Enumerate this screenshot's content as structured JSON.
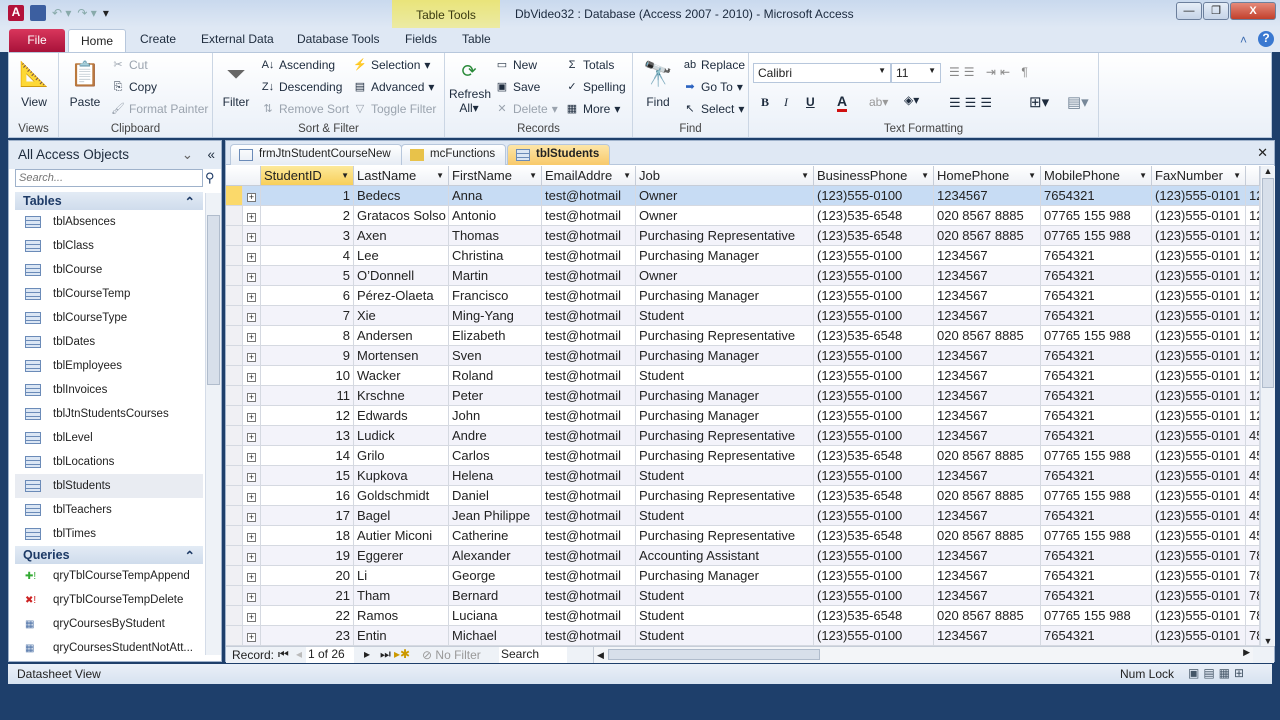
{
  "window": {
    "title": "DbVideo32 : Database (Access 2007 - 2010)  -  Microsoft Access",
    "contextual": "Table Tools",
    "min": "—",
    "max": "❐",
    "close": "X"
  },
  "ribbon_tabs": [
    "File",
    "Home",
    "Create",
    "External Data",
    "Database Tools",
    "Fields",
    "Table"
  ],
  "ribbon": {
    "views": {
      "view": "View",
      "label": "Views"
    },
    "clipboard": {
      "paste": "Paste",
      "cut": "Cut",
      "copy": "Copy",
      "format_painter": "Format Painter",
      "label": "Clipboard"
    },
    "sort_filter": {
      "filter": "Filter",
      "ascending": "Ascending",
      "descending": "Descending",
      "remove_sort": "Remove Sort",
      "selection": "Selection",
      "advanced": "Advanced",
      "toggle_filter": "Toggle Filter",
      "label": "Sort & Filter"
    },
    "records": {
      "refresh": "Refresh",
      "refresh2": "All",
      "new": "New",
      "save": "Save",
      "delete": "Delete",
      "totals": "Totals",
      "spelling": "Spelling",
      "more": "More",
      "label": "Records"
    },
    "find": {
      "find": "Find",
      "replace": "Replace",
      "goto": "Go To",
      "select": "Select",
      "label": "Find"
    },
    "text_formatting": {
      "font": "Calibri",
      "size": "11",
      "bold": "B",
      "italic": "I",
      "underline": "U",
      "label": "Text Formatting"
    }
  },
  "nav": {
    "title": "All Access Objects",
    "search_placeholder": "Search...",
    "tables_label": "Tables",
    "queries_label": "Queries",
    "tables": [
      "tblAbsences",
      "tblClass",
      "tblCourse",
      "tblCourseTemp",
      "tblCourseType",
      "tblDates",
      "tblEmployees",
      "tblInvoices",
      "tblJtnStudentsCourses",
      "tblLevel",
      "tblLocations",
      "tblStudents",
      "tblTeachers",
      "tblTimes"
    ],
    "queries": [
      "qryTblCourseTempAppend",
      "qryTblCourseTempDelete",
      "qryCoursesByStudent",
      "qryCoursesStudentNotAtt..."
    ]
  },
  "doc_tabs": [
    "frmJtnStudentCourseNew",
    "mcFunctions",
    "tblStudents"
  ],
  "columns": [
    "StudentID",
    "LastName",
    "FirstName",
    "EmailAddre",
    "Job",
    "BusinessPhone",
    "HomePhone",
    "MobilePhone",
    "FaxNumber"
  ],
  "rows": [
    [
      "1",
      "Bedecs",
      "Anna",
      "test@hotmail",
      "Owner",
      "(123)555-0100",
      "1234567",
      "7654321",
      "(123)555-0101",
      "12"
    ],
    [
      "2",
      "Gratacos Solso",
      "Antonio",
      "test@hotmail",
      "Owner",
      "(123)535-6548",
      "020 8567 8885",
      "07765 155 988",
      "(123)555-0101",
      "12"
    ],
    [
      "3",
      "Axen",
      "Thomas",
      "test@hotmail",
      "Purchasing Representative",
      "(123)535-6548",
      "020 8567 8885",
      "07765 155 988",
      "(123)555-0101",
      "12"
    ],
    [
      "4",
      "Lee",
      "Christina",
      "test@hotmail",
      "Purchasing Manager",
      "(123)555-0100",
      "1234567",
      "7654321",
      "(123)555-0101",
      "12"
    ],
    [
      "5",
      "O’Donnell",
      "Martin",
      "test@hotmail",
      "Owner",
      "(123)555-0100",
      "1234567",
      "7654321",
      "(123)555-0101",
      "12"
    ],
    [
      "6",
      "Pérez-Olaeta",
      "Francisco",
      "test@hotmail",
      "Purchasing Manager",
      "(123)555-0100",
      "1234567",
      "7654321",
      "(123)555-0101",
      "12"
    ],
    [
      "7",
      "Xie",
      "Ming-Yang",
      "test@hotmail",
      "Student",
      "(123)555-0100",
      "1234567",
      "7654321",
      "(123)555-0101",
      "12"
    ],
    [
      "8",
      "Andersen",
      "Elizabeth",
      "test@hotmail",
      "Purchasing Representative",
      "(123)535-6548",
      "020 8567 8885",
      "07765 155 988",
      "(123)555-0101",
      "12"
    ],
    [
      "9",
      "Mortensen",
      "Sven",
      "test@hotmail",
      "Purchasing Manager",
      "(123)555-0100",
      "1234567",
      "7654321",
      "(123)555-0101",
      "12"
    ],
    [
      "10",
      "Wacker",
      "Roland",
      "test@hotmail",
      "Student",
      "(123)555-0100",
      "1234567",
      "7654321",
      "(123)555-0101",
      "12"
    ],
    [
      "11",
      "Krschne",
      "Peter",
      "test@hotmail",
      "Purchasing Manager",
      "(123)555-0100",
      "1234567",
      "7654321",
      "(123)555-0101",
      "12"
    ],
    [
      "12",
      "Edwards",
      "John",
      "test@hotmail",
      "Purchasing Manager",
      "(123)555-0100",
      "1234567",
      "7654321",
      "(123)555-0101",
      "12"
    ],
    [
      "13",
      "Ludick",
      "Andre",
      "test@hotmail",
      "Purchasing Representative",
      "(123)555-0100",
      "1234567",
      "7654321",
      "(123)555-0101",
      "45"
    ],
    [
      "14",
      "Grilo",
      "Carlos",
      "test@hotmail",
      "Purchasing Representative",
      "(123)535-6548",
      "020 8567 8885",
      "07765 155 988",
      "(123)555-0101",
      "45"
    ],
    [
      "15",
      "Kupkova",
      "Helena",
      "test@hotmail",
      "Student",
      "(123)555-0100",
      "1234567",
      "7654321",
      "(123)555-0101",
      "45"
    ],
    [
      "16",
      "Goldschmidt",
      "Daniel",
      "test@hotmail",
      "Purchasing Representative",
      "(123)535-6548",
      "020 8567 8885",
      "07765 155 988",
      "(123)555-0101",
      "45"
    ],
    [
      "17",
      "Bagel",
      "Jean Philippe",
      "test@hotmail",
      "Student",
      "(123)555-0100",
      "1234567",
      "7654321",
      "(123)555-0101",
      "45"
    ],
    [
      "18",
      "Autier Miconi",
      "Catherine",
      "test@hotmail",
      "Purchasing Representative",
      "(123)535-6548",
      "020 8567 8885",
      "07765 155 988",
      "(123)555-0101",
      "45"
    ],
    [
      "19",
      "Eggerer",
      "Alexander",
      "test@hotmail",
      "Accounting Assistant",
      "(123)555-0100",
      "1234567",
      "7654321",
      "(123)555-0101",
      "78"
    ],
    [
      "20",
      "Li",
      "George",
      "test@hotmail",
      "Purchasing Manager",
      "(123)555-0100",
      "1234567",
      "7654321",
      "(123)555-0101",
      "78"
    ],
    [
      "21",
      "Tham",
      "Bernard",
      "test@hotmail",
      "Student",
      "(123)555-0100",
      "1234567",
      "7654321",
      "(123)555-0101",
      "78"
    ],
    [
      "22",
      "Ramos",
      "Luciana",
      "test@hotmail",
      "Student",
      "(123)535-6548",
      "020 8567 8885",
      "07765 155 988",
      "(123)555-0101",
      "78"
    ],
    [
      "23",
      "Entin",
      "Michael",
      "test@hotmail",
      "Student",
      "(123)555-0100",
      "1234567",
      "7654321",
      "(123)555-0101",
      "78"
    ]
  ],
  "record_nav": {
    "label": "Record:",
    "position": "1 of 26",
    "no_filter": "No Filter",
    "search": "Search"
  },
  "status": {
    "view": "Datasheet View",
    "num_lock": "Num Lock"
  }
}
